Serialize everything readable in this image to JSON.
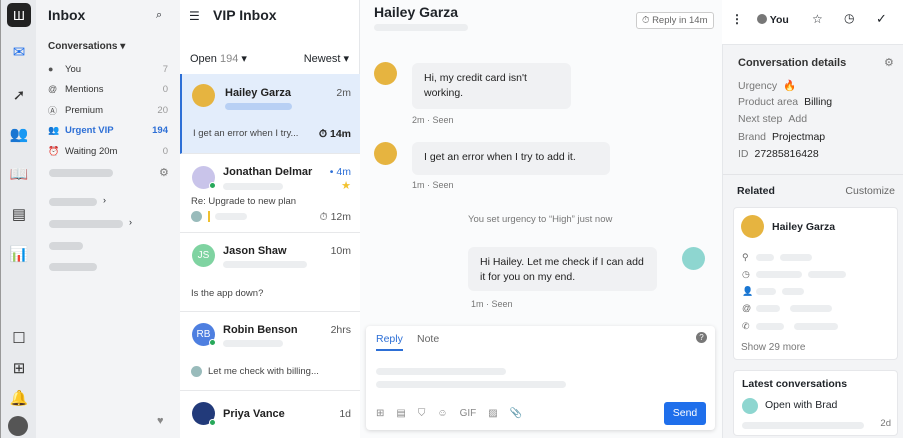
{
  "nav": {
    "title": "Inbox",
    "section": "Conversations",
    "items": [
      {
        "label": "You",
        "count": "7"
      },
      {
        "label": "Mentions",
        "count": "0"
      },
      {
        "label": "Premium",
        "count": "20"
      },
      {
        "label": "Urgent VIP",
        "count": "194"
      },
      {
        "label": "Waiting 20m",
        "count": "0"
      }
    ]
  },
  "list": {
    "title": "VIP Inbox",
    "filter": "Open",
    "filter_count": "194",
    "sort": "Newest",
    "items": [
      {
        "name": "Hailey Garza",
        "time": "2m",
        "preview": "I get an error when I try...",
        "sla": "14m"
      },
      {
        "name": "Jonathan Delmar",
        "time": "4m",
        "preview": "Re: Upgrade to new plan",
        "sla": "12m"
      },
      {
        "name": "Jason Shaw",
        "initials": "JS",
        "time": "10m",
        "preview": "Is the app down?"
      },
      {
        "name": "Robin Benson",
        "initials": "RB",
        "time": "2hrs",
        "preview": "Let me check with billing..."
      },
      {
        "name": "Priya Vance",
        "time": "1d"
      }
    ]
  },
  "conversation": {
    "title": "Hailey Garza",
    "reply_in": "Reply in 14m",
    "assignee": "You",
    "messages": [
      {
        "text": "Hi, my credit card isn't working.",
        "meta": "2m · Seen"
      },
      {
        "text": "I get an error when I try to add it.",
        "meta": "1m · Seen"
      },
      {
        "text": "Hi Hailey. Let me check if I can add it for you on my end.",
        "meta": "1m · Seen"
      }
    ],
    "event": "You set urgency to “High” just now",
    "composer": {
      "tab_reply": "Reply",
      "tab_note": "Note",
      "gif": "GIF",
      "send": "Send"
    }
  },
  "details": {
    "title": "Conversation details",
    "urgency_label": "Urgency",
    "urgency_value": "🔥",
    "product_label": "Product area",
    "product_value": "Billing",
    "next_label": "Next step",
    "next_value": "Add",
    "brand_label": "Brand",
    "brand_value": "Projectmap",
    "id_label": "ID",
    "id_value": "27285816428",
    "related": "Related",
    "customize": "Customize",
    "contact_name": "Hailey Garza",
    "show_more": "Show 29 more",
    "latest_title": "Latest conversations",
    "latest_item": "Open with Brad",
    "latest_time": "2d"
  },
  "colors": {
    "accent": "#1f6feb",
    "selected": "#e3edfb",
    "online": "#27a85a"
  }
}
